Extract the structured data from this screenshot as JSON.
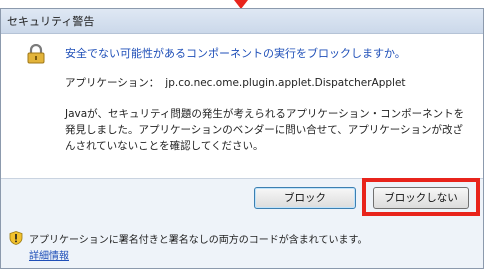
{
  "dialog": {
    "title": "セキュリティ警告",
    "heading": "安全でない可能性があるコンポーネントの実行をブロックしますか。",
    "application_label": "アプリケーション：",
    "application_value": "jp.co.nec.ome.plugin.applet.DispatcherApplet",
    "description": "Javaが、セキュリティ問題の発生が考えられるアプリケーション・コンポーネントを発見しました。アプリケーションのベンダーに問い合せて、アプリケーションが改ざんされていないことを確認してください。",
    "buttons": {
      "block": "ブロック",
      "dont_block": "ブロックしない"
    },
    "footer_text": "アプリケーションに署名付きと署名なしの両方のコードが含まれています。",
    "more_info_link": "詳細情報"
  },
  "colors": {
    "highlight": "#e8241c",
    "heading": "#1f4fb8"
  },
  "icons": {
    "heading_icon": "lock-icon",
    "footer_icon": "shield-warning-icon"
  }
}
